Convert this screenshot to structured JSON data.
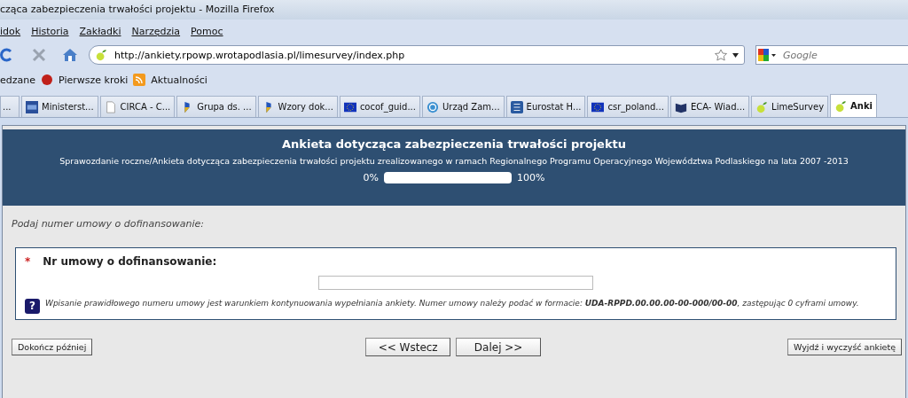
{
  "window": {
    "title": "cząca zabezpieczenia trwałości projektu - Mozilla Firefox"
  },
  "menu": [
    "idok",
    "Historia",
    "Zakładki",
    "Narzędzia",
    "Pomoc"
  ],
  "address_bar": {
    "value": "http://ankiety.rpowp.wrotapodlasia.pl/limesurvey/index.php"
  },
  "search": {
    "placeholder": "Google"
  },
  "bookmarks": [
    "edzane",
    "Pierwsze kroki",
    "Aktualności"
  ],
  "tabs": [
    {
      "label": "...",
      "kind": "none",
      "selected": false
    },
    {
      "label": "Ministerst...",
      "kind": "mrr",
      "selected": false
    },
    {
      "label": "CIRCA - C...",
      "kind": "page",
      "selected": false
    },
    {
      "label": "Grupa ds. ...",
      "kind": "flag",
      "selected": false
    },
    {
      "label": "Wzory dok...",
      "kind": "flag",
      "selected": false
    },
    {
      "label": "cocof_guid...",
      "kind": "eu",
      "selected": false
    },
    {
      "label": "Urząd Zam...",
      "kind": "circle",
      "selected": false
    },
    {
      "label": "Eurostat H...",
      "kind": "stat",
      "selected": false
    },
    {
      "label": "csr_poland...",
      "kind": "eu",
      "selected": false
    },
    {
      "label": "ECA- Wiad...",
      "kind": "book",
      "selected": false
    },
    {
      "label": "LimeSurvey",
      "kind": "lime",
      "selected": false
    },
    {
      "label": "Anki",
      "kind": "lime",
      "selected": true
    }
  ],
  "survey": {
    "title": "Ankieta dotycząca zabezpieczenia trwałości projektu",
    "description": "Sprawozdanie roczne/Ankieta dotycząca zabezpieczenia trwałości projektu zrealizowanego w ramach Regionalnego Programu Operacyjnego Województwa Podlaskiego na lata 2007 -2013",
    "progress": {
      "start": "0%",
      "end": "100%",
      "level": 0
    },
    "group_description": "Podaj numer umowy o dofinansowanie:",
    "question": {
      "mandatory": true,
      "mark": "*",
      "label": "Nr umowy o dofinansowanie:",
      "help_icon": "?",
      "help": "Wpisanie prawidłowego numeru umowy jest warunkiem kontynuowania wypełniania ankiety. Numer umowy należy podać w formacie: **UDA-RPPD.00.00.00-00-000/00-00**, zastępując 0 cyframi umowy."
    },
    "buttons": {
      "later": "Dokończ później",
      "back": "<< Wstecz",
      "next": "Dalej >>",
      "exit": "Wyjdź i wyczyść ankietę"
    }
  }
}
